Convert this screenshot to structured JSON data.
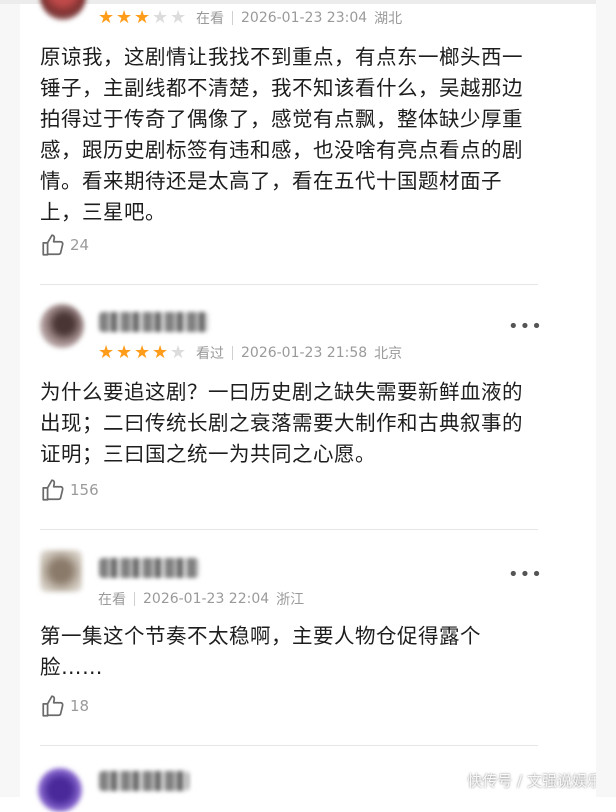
{
  "comments": [
    {
      "rating": 3,
      "status": "在看",
      "datetime": "2026-01-23 23:04",
      "location": "湖北",
      "text": "原谅我，这剧情让我找不到重点，有点东一榔头西一锤子，主副线都不清楚，我不知该看什么，吴越那边拍得过于传奇了偶像了，感觉有点飘，整体缺少厚重感，跟历史剧标签有违和感，也没啥有亮点看点的剧情。看来期待还是太高了，看在五代十国题材面子上，三星吧。",
      "likes": "24"
    },
    {
      "rating": 4,
      "status": "看过",
      "datetime": "2026-01-23 21:58",
      "location": "北京",
      "text": "为什么要追这剧？一曰历史剧之缺失需要新鲜血液的出现；二曰传统长剧之衰落需要大制作和古典叙事的证明；三曰国之统一为共同之心愿。",
      "likes": "156"
    },
    {
      "status": "在看",
      "datetime": "2026-01-23 22:04",
      "location": "浙江",
      "text": "第一集这个节奏不太稳啊，主要人物仓促得露个脸……",
      "likes": "18"
    }
  ],
  "more_icon": "more-horizontal-icon",
  "like_icon": "thumbs-up-icon",
  "star_color": "#ff9c1a",
  "watermark": "快传号 / 文强说娱乐"
}
